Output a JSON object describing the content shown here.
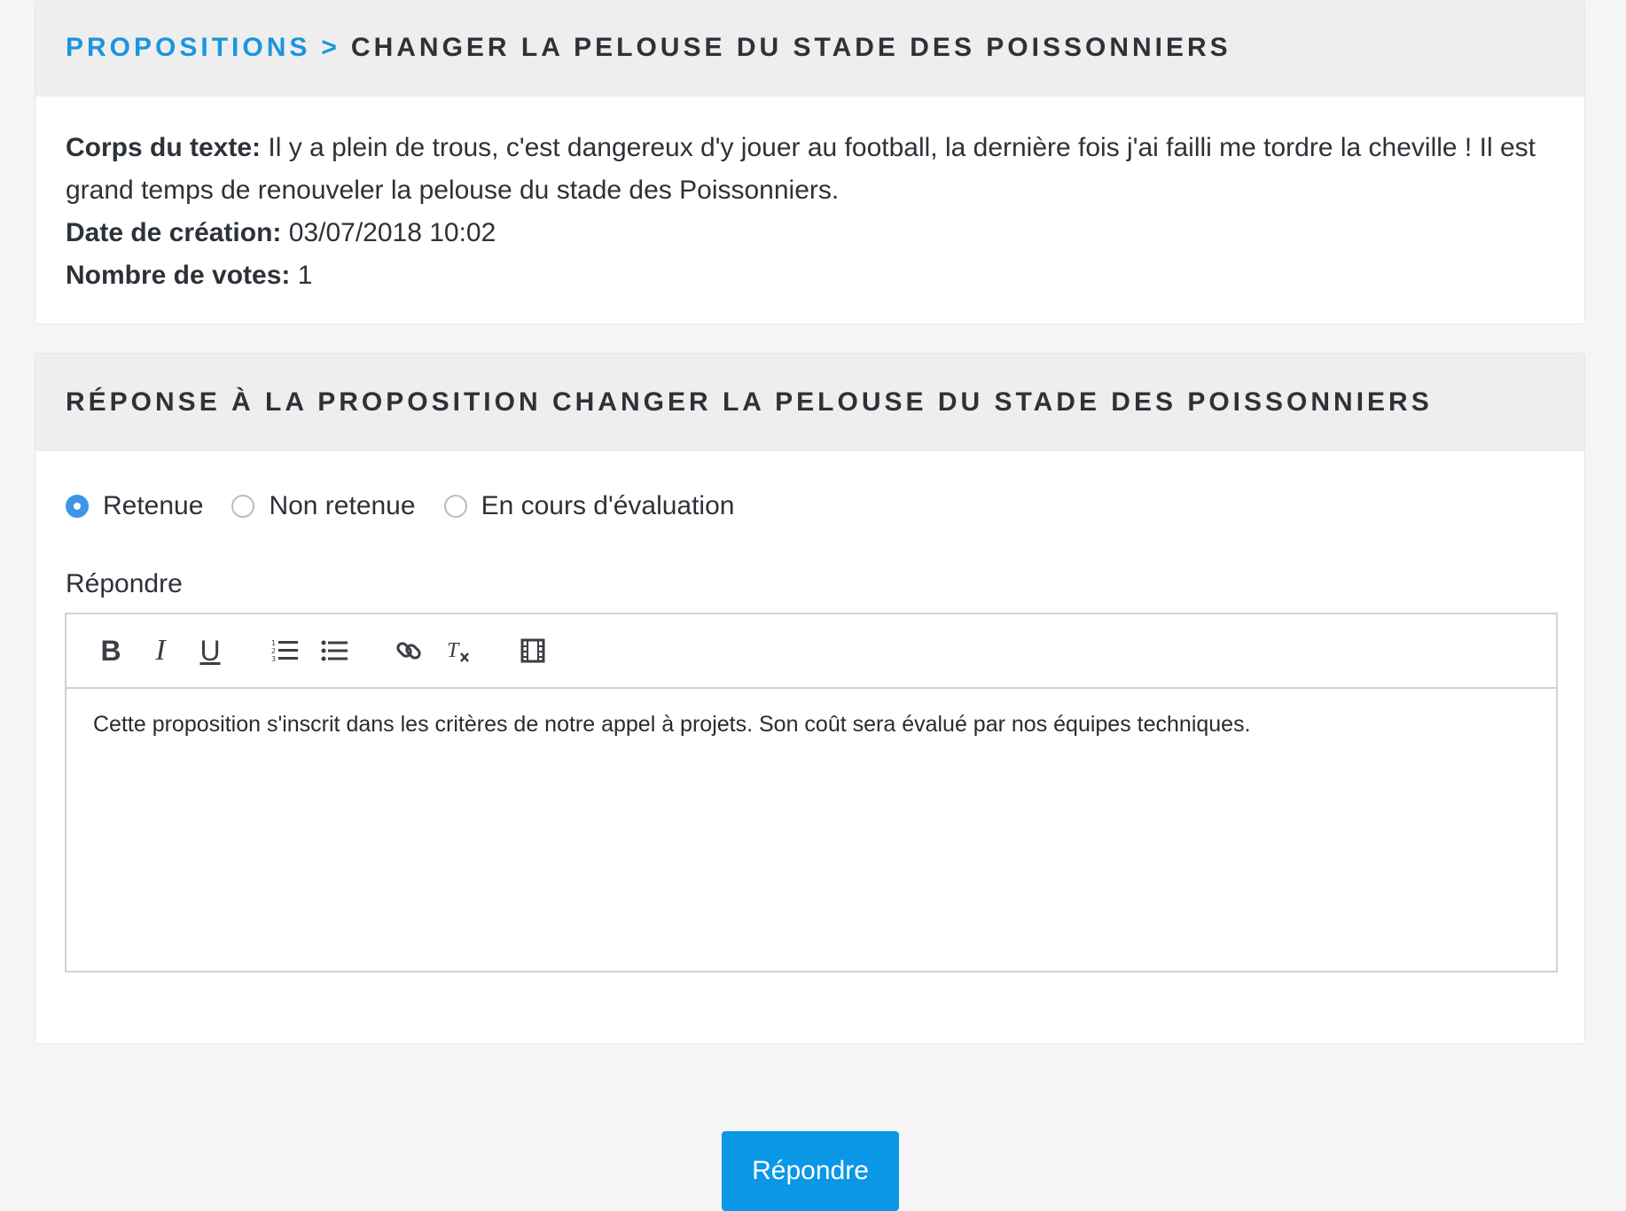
{
  "breadcrumb": {
    "link": "Propositions",
    "separator": ">",
    "current": "Changer la pelouse du stade des Poissonniers"
  },
  "proposal": {
    "body_label": "Corps du texte:",
    "body_value": "Il y a plein de trous, c'est dangereux d'y jouer au football, la dernière fois j'ai failli me tordre la cheville ! Il est grand temps de renouveler la pelouse du stade des Poissonniers.",
    "date_label": "Date de création:",
    "date_value": "03/07/2018 10:02",
    "votes_label": "Nombre de votes:",
    "votes_value": "1"
  },
  "response": {
    "title": "Réponse à la proposition Changer la pelouse du stade des Poissonniers",
    "status_options": [
      {
        "label": "Retenue",
        "checked": true
      },
      {
        "label": "Non retenue",
        "checked": false
      },
      {
        "label": "En cours d'évaluation",
        "checked": false
      }
    ],
    "reply_label": "Répondre",
    "editor_text": "Cette proposition s'inscrit dans les critères de notre appel à projets. Son coût sera évalué par nos équipes techniques.",
    "toolbar": {
      "bold": "B",
      "italic": "I",
      "underline": "U",
      "icons": [
        "ordered-list-icon",
        "bullet-list-icon",
        "link-icon",
        "clear-format-icon",
        "video-icon"
      ]
    }
  },
  "submit_label": "Répondre",
  "colors": {
    "accent": "#0a97e6",
    "radio_checked": "#3d95e8",
    "header_bg": "#eeeeef",
    "page_bg": "#f5f5f5"
  }
}
